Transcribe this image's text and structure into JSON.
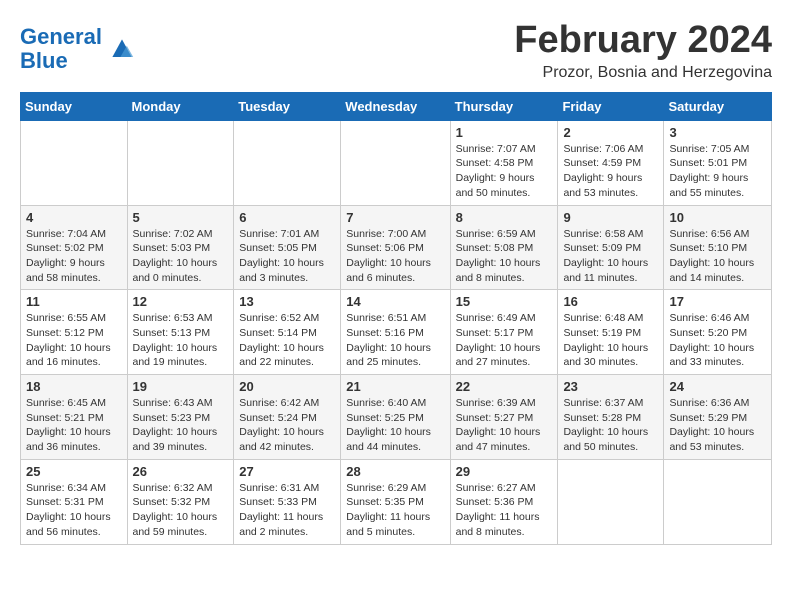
{
  "logo": {
    "line1": "General",
    "line2": "Blue"
  },
  "title": "February 2024",
  "location": "Prozor, Bosnia and Herzegovina",
  "weekdays": [
    "Sunday",
    "Monday",
    "Tuesday",
    "Wednesday",
    "Thursday",
    "Friday",
    "Saturday"
  ],
  "weeks": [
    [
      {
        "day": "",
        "info": ""
      },
      {
        "day": "",
        "info": ""
      },
      {
        "day": "",
        "info": ""
      },
      {
        "day": "",
        "info": ""
      },
      {
        "day": "1",
        "info": "Sunrise: 7:07 AM\nSunset: 4:58 PM\nDaylight: 9 hours and 50 minutes."
      },
      {
        "day": "2",
        "info": "Sunrise: 7:06 AM\nSunset: 4:59 PM\nDaylight: 9 hours and 53 minutes."
      },
      {
        "day": "3",
        "info": "Sunrise: 7:05 AM\nSunset: 5:01 PM\nDaylight: 9 hours and 55 minutes."
      }
    ],
    [
      {
        "day": "4",
        "info": "Sunrise: 7:04 AM\nSunset: 5:02 PM\nDaylight: 9 hours and 58 minutes."
      },
      {
        "day": "5",
        "info": "Sunrise: 7:02 AM\nSunset: 5:03 PM\nDaylight: 10 hours and 0 minutes."
      },
      {
        "day": "6",
        "info": "Sunrise: 7:01 AM\nSunset: 5:05 PM\nDaylight: 10 hours and 3 minutes."
      },
      {
        "day": "7",
        "info": "Sunrise: 7:00 AM\nSunset: 5:06 PM\nDaylight: 10 hours and 6 minutes."
      },
      {
        "day": "8",
        "info": "Sunrise: 6:59 AM\nSunset: 5:08 PM\nDaylight: 10 hours and 8 minutes."
      },
      {
        "day": "9",
        "info": "Sunrise: 6:58 AM\nSunset: 5:09 PM\nDaylight: 10 hours and 11 minutes."
      },
      {
        "day": "10",
        "info": "Sunrise: 6:56 AM\nSunset: 5:10 PM\nDaylight: 10 hours and 14 minutes."
      }
    ],
    [
      {
        "day": "11",
        "info": "Sunrise: 6:55 AM\nSunset: 5:12 PM\nDaylight: 10 hours and 16 minutes."
      },
      {
        "day": "12",
        "info": "Sunrise: 6:53 AM\nSunset: 5:13 PM\nDaylight: 10 hours and 19 minutes."
      },
      {
        "day": "13",
        "info": "Sunrise: 6:52 AM\nSunset: 5:14 PM\nDaylight: 10 hours and 22 minutes."
      },
      {
        "day": "14",
        "info": "Sunrise: 6:51 AM\nSunset: 5:16 PM\nDaylight: 10 hours and 25 minutes."
      },
      {
        "day": "15",
        "info": "Sunrise: 6:49 AM\nSunset: 5:17 PM\nDaylight: 10 hours and 27 minutes."
      },
      {
        "day": "16",
        "info": "Sunrise: 6:48 AM\nSunset: 5:19 PM\nDaylight: 10 hours and 30 minutes."
      },
      {
        "day": "17",
        "info": "Sunrise: 6:46 AM\nSunset: 5:20 PM\nDaylight: 10 hours and 33 minutes."
      }
    ],
    [
      {
        "day": "18",
        "info": "Sunrise: 6:45 AM\nSunset: 5:21 PM\nDaylight: 10 hours and 36 minutes."
      },
      {
        "day": "19",
        "info": "Sunrise: 6:43 AM\nSunset: 5:23 PM\nDaylight: 10 hours and 39 minutes."
      },
      {
        "day": "20",
        "info": "Sunrise: 6:42 AM\nSunset: 5:24 PM\nDaylight: 10 hours and 42 minutes."
      },
      {
        "day": "21",
        "info": "Sunrise: 6:40 AM\nSunset: 5:25 PM\nDaylight: 10 hours and 44 minutes."
      },
      {
        "day": "22",
        "info": "Sunrise: 6:39 AM\nSunset: 5:27 PM\nDaylight: 10 hours and 47 minutes."
      },
      {
        "day": "23",
        "info": "Sunrise: 6:37 AM\nSunset: 5:28 PM\nDaylight: 10 hours and 50 minutes."
      },
      {
        "day": "24",
        "info": "Sunrise: 6:36 AM\nSunset: 5:29 PM\nDaylight: 10 hours and 53 minutes."
      }
    ],
    [
      {
        "day": "25",
        "info": "Sunrise: 6:34 AM\nSunset: 5:31 PM\nDaylight: 10 hours and 56 minutes."
      },
      {
        "day": "26",
        "info": "Sunrise: 6:32 AM\nSunset: 5:32 PM\nDaylight: 10 hours and 59 minutes."
      },
      {
        "day": "27",
        "info": "Sunrise: 6:31 AM\nSunset: 5:33 PM\nDaylight: 11 hours and 2 minutes."
      },
      {
        "day": "28",
        "info": "Sunrise: 6:29 AM\nSunset: 5:35 PM\nDaylight: 11 hours and 5 minutes."
      },
      {
        "day": "29",
        "info": "Sunrise: 6:27 AM\nSunset: 5:36 PM\nDaylight: 11 hours and 8 minutes."
      },
      {
        "day": "",
        "info": ""
      },
      {
        "day": "",
        "info": ""
      }
    ]
  ]
}
